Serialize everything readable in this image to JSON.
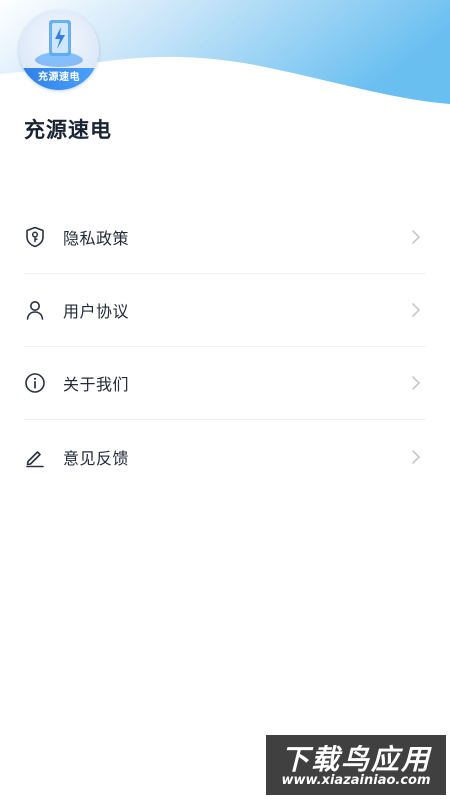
{
  "app": {
    "logo_text": "充源速电",
    "title": "充源速电"
  },
  "menu": {
    "items": [
      {
        "label": "隐私政策",
        "icon": "shield-key-icon"
      },
      {
        "label": "用户协议",
        "icon": "person-icon"
      },
      {
        "label": "关于我们",
        "icon": "info-icon"
      },
      {
        "label": "意见反馈",
        "icon": "pen-icon"
      }
    ]
  },
  "watermark": {
    "main": "下载鸟应用",
    "url": "www.xiazainiao.com"
  },
  "colors": {
    "header_gradient_start": "#ffffff",
    "header_gradient_end": "#69bff0",
    "text_primary": "#1b2433",
    "chevron": "#c4c8cf",
    "divider": "#f0f1f3"
  }
}
